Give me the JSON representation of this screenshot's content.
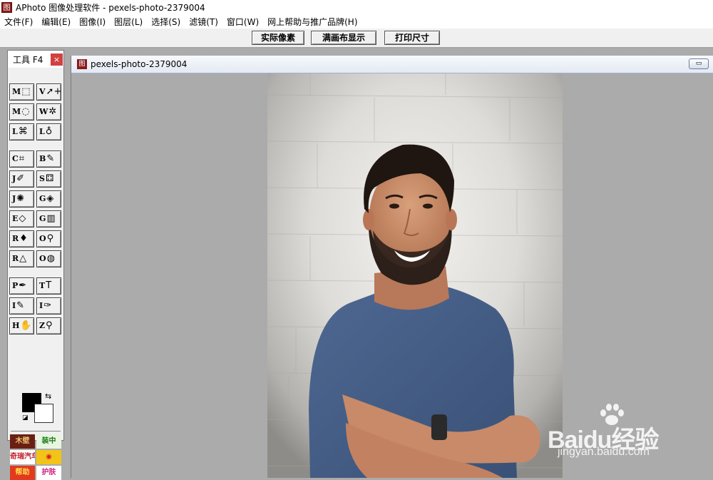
{
  "app": {
    "title": "APhoto 图像处理软件 - pexels-photo-2379004",
    "icon_glyph": "图"
  },
  "menu": [
    {
      "id": "file",
      "label": "文件(F)"
    },
    {
      "id": "edit",
      "label": "编辑(E)"
    },
    {
      "id": "image",
      "label": "图像(I)"
    },
    {
      "id": "layer",
      "label": "图层(L)"
    },
    {
      "id": "select",
      "label": "选择(S)"
    },
    {
      "id": "filter",
      "label": "滤镜(T)"
    },
    {
      "id": "window",
      "label": "窗口(W)"
    },
    {
      "id": "help",
      "label": "网上帮助与推广品牌(H)"
    }
  ],
  "toolbar": {
    "actual_pixels": "实际像素",
    "fit_canvas": "满画布显示",
    "print_size": "打印尺寸"
  },
  "tool_palette": {
    "title": "工具 F4",
    "close": "×",
    "tools": [
      {
        "key": "M",
        "glyph": "⬚",
        "name": "rect-marquee"
      },
      {
        "key": "V",
        "glyph": "➚+",
        "name": "move"
      },
      {
        "key": "M",
        "glyph": "◌",
        "name": "ellipse-marquee"
      },
      {
        "key": "W",
        "glyph": "✲",
        "name": "magic-wand"
      },
      {
        "key": "L",
        "glyph": "⌘",
        "name": "poly-lasso"
      },
      {
        "key": "L",
        "glyph": "♁",
        "name": "lasso"
      },
      {
        "key": "C",
        "glyph": "⌗",
        "name": "crop"
      },
      {
        "key": "B",
        "glyph": "✎",
        "name": "brush"
      },
      {
        "key": "J",
        "glyph": "✐",
        "name": "healing"
      },
      {
        "key": "S",
        "glyph": "⚃",
        "name": "clone-stamp"
      },
      {
        "key": "J",
        "glyph": "✺",
        "name": "spot-heal"
      },
      {
        "key": "G",
        "glyph": "◈",
        "name": "paint-bucket"
      },
      {
        "key": "E",
        "glyph": "◇",
        "name": "eraser"
      },
      {
        "key": "G",
        "glyph": "▥",
        "name": "gradient"
      },
      {
        "key": "R",
        "glyph": "♦",
        "name": "blur"
      },
      {
        "key": "O",
        "glyph": "⚲",
        "name": "dodge"
      },
      {
        "key": "R",
        "glyph": "△",
        "name": "sharpen"
      },
      {
        "key": "O",
        "glyph": "◍",
        "name": "sponge"
      },
      {
        "key": "P",
        "glyph": "✒",
        "name": "pen"
      },
      {
        "key": "T",
        "glyph": "T",
        "name": "text"
      },
      {
        "key": "I",
        "glyph": "✎",
        "name": "measure"
      },
      {
        "key": "I",
        "glyph": "✑",
        "name": "eyedropper"
      },
      {
        "key": "H",
        "glyph": "✋",
        "name": "hand"
      },
      {
        "key": "Z",
        "glyph": "⚲",
        "name": "zoom"
      }
    ],
    "ads": [
      {
        "label": "木壁",
        "bg": "#6b1f14",
        "fg": "#e8c070"
      },
      {
        "label": "装中",
        "bg": "#e8f5e0",
        "fg": "#1a7a1a"
      },
      {
        "label": "奇瑞汽车",
        "bg": "#ffffff",
        "fg": "#c0202a"
      },
      {
        "label": "◉",
        "bg": "#f2c418",
        "fg": "#d0202a"
      },
      {
        "label": "帮助",
        "bg": "#e23a1e",
        "fg": "#ffe050"
      },
      {
        "label": "护肤",
        "bg": "#ffffff",
        "fg": "#d02080"
      }
    ]
  },
  "document": {
    "title": "pexels-photo-2379004",
    "icon_glyph": "图",
    "minimize": "▭"
  },
  "colors": {
    "foreground": "#000000",
    "background": "#ffffff"
  },
  "watermark": {
    "main": "Baidu经验",
    "sub": "jingyan.baidu.com"
  }
}
